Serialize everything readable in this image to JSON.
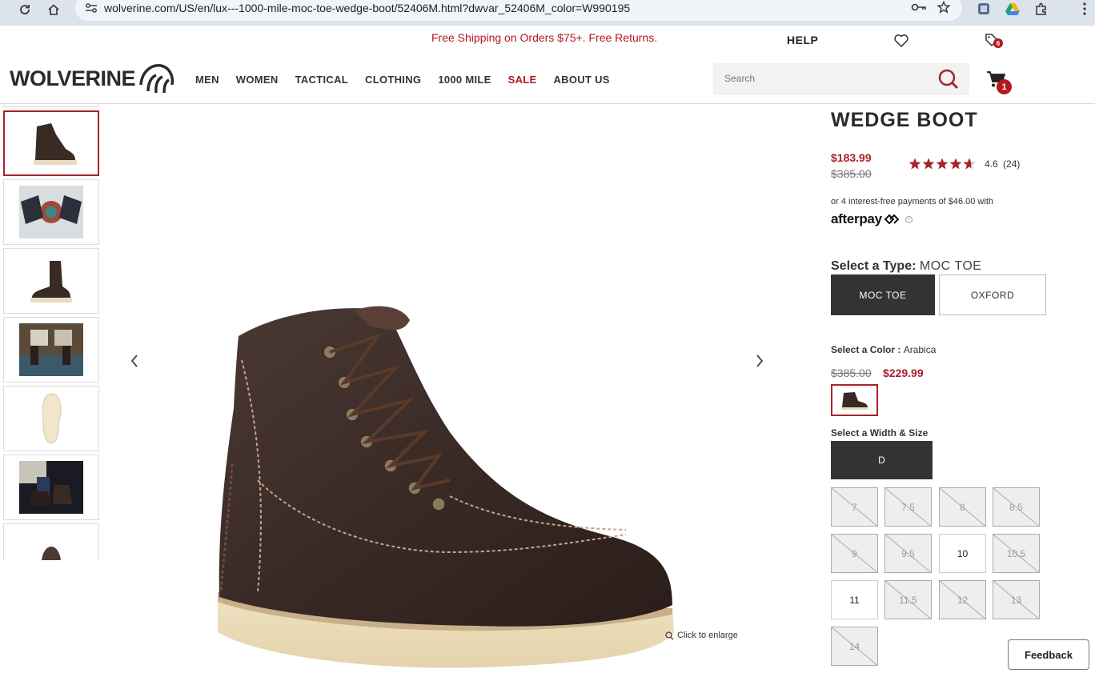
{
  "browser": {
    "url": "wolverine.com/US/en/lux---1000-mile-moc-toe-wedge-boot/52406M.html?dwvar_52406M_color=W990195"
  },
  "header": {
    "promo": "Free Shipping on Orders $75+. Free Returns.",
    "help": "HELP",
    "notifications_count": "6",
    "cart_count": "1",
    "logo_text": "WOLVERINE",
    "nav": [
      {
        "label": "MEN"
      },
      {
        "label": "WOMEN"
      },
      {
        "label": "TACTICAL"
      },
      {
        "label": "CLOTHING"
      },
      {
        "label": "1000 MILE"
      },
      {
        "label": "SALE"
      },
      {
        "label": "ABOUT US"
      }
    ],
    "search_placeholder": "Search"
  },
  "gallery": {
    "enlarge_label": "Click to enlarge"
  },
  "product": {
    "title": "WEDGE BOOT",
    "sale_price": "$183.99",
    "original_price": "$385.00",
    "rating_value": 4.6,
    "rating_text": "4.6",
    "review_count": "(24)",
    "afterpay_text": "or 4 interest-free payments of $46.00 with",
    "afterpay_logo": "afterpay",
    "type_label": "Select a Type:",
    "type_value": "MOC TOE",
    "types": [
      {
        "label": "MOC TOE",
        "selected": true
      },
      {
        "label": "OXFORD",
        "selected": false
      }
    ],
    "color_label": "Select a Color :",
    "color_value": "Arabica",
    "color_original_price": "$385.00",
    "color_sale_price": "$229.99",
    "size_label": "Select a Width & Size",
    "width": "D",
    "sizes": [
      {
        "label": "7",
        "available": false
      },
      {
        "label": "7.5",
        "available": false
      },
      {
        "label": "8",
        "available": false
      },
      {
        "label": "8.5",
        "available": false
      },
      {
        "label": "9",
        "available": false
      },
      {
        "label": "9.5",
        "available": false
      },
      {
        "label": "10",
        "available": true
      },
      {
        "label": "10.5",
        "available": false
      },
      {
        "label": "11",
        "available": true
      },
      {
        "label": "11.5",
        "available": false
      },
      {
        "label": "12",
        "available": false
      },
      {
        "label": "13",
        "available": false
      },
      {
        "label": "14",
        "available": false
      }
    ]
  },
  "feedback": "Feedback",
  "colors": {
    "accent_red": "#a8232a",
    "dark": "#333333"
  }
}
